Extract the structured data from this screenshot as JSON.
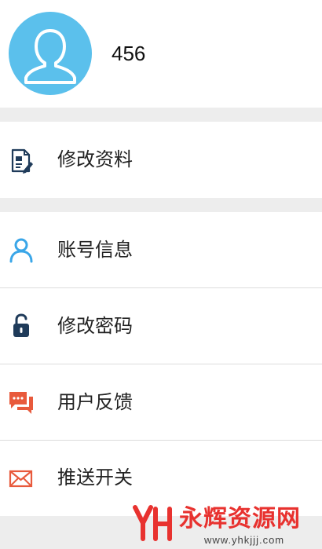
{
  "profile": {
    "username": "456",
    "avatar_icon": "user-silhouette-icon",
    "avatar_color": "#5bc0ec"
  },
  "menu": {
    "edit_profile": {
      "label": "修改资料",
      "icon": "document-edit-icon",
      "icon_color": "#1f3b5a"
    },
    "account_info": {
      "label": "账号信息",
      "icon": "person-outline-icon",
      "icon_color": "#3aa6e8"
    },
    "change_password": {
      "label": "修改密码",
      "icon": "padlock-icon",
      "icon_color": "#1f3b5a"
    },
    "feedback": {
      "label": "用户反馈",
      "icon": "chat-bubbles-icon",
      "icon_color": "#e85a3c"
    },
    "push_switch": {
      "label": "推送开关",
      "icon": "envelope-icon",
      "icon_color": "#e85a3c"
    }
  },
  "watermark": {
    "title": "永辉资源网",
    "url": "www.yhkjjj.com",
    "accent": "#e8322f"
  }
}
